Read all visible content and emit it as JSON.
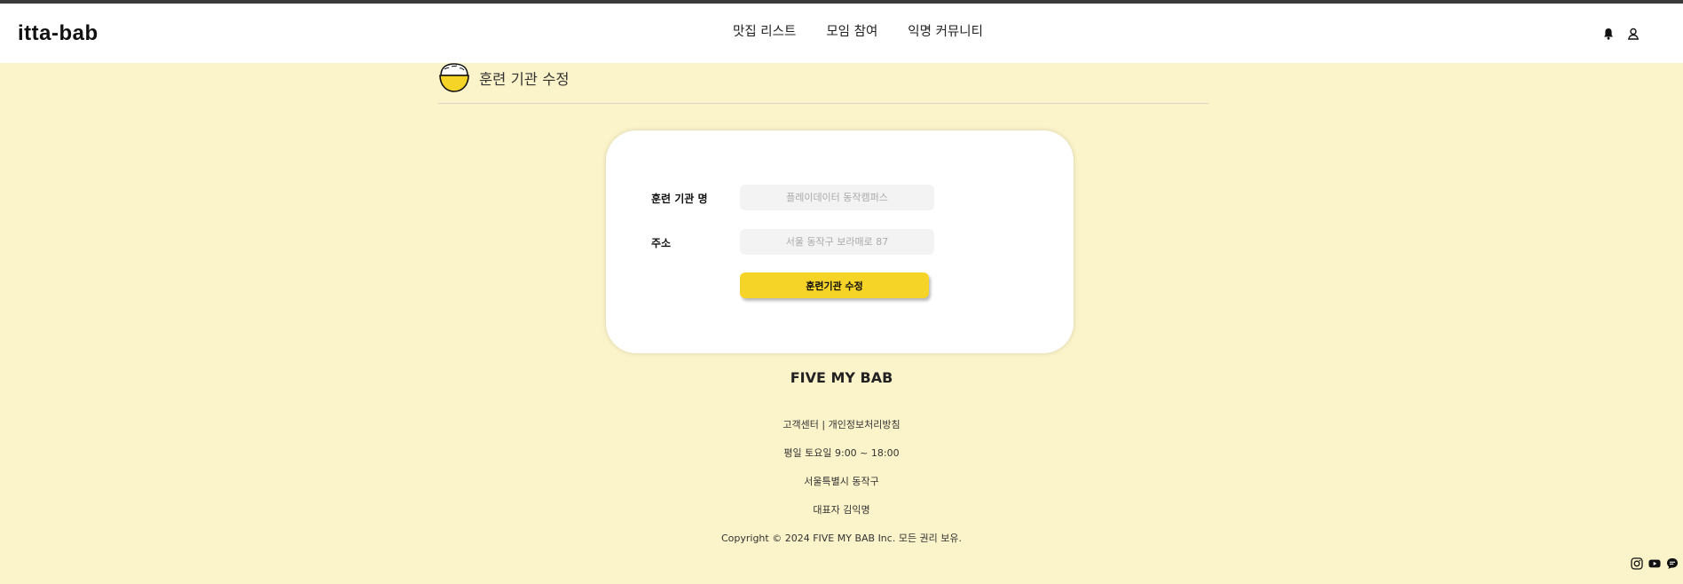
{
  "app": {
    "logo": "itta-bab"
  },
  "nav": {
    "items": [
      "맛집 리스트",
      "모임 참여",
      "익명 커뮤니티"
    ]
  },
  "header_icons": [
    "bell-icon",
    "user-icon"
  ],
  "page": {
    "title": "훈련 기관 수정"
  },
  "form": {
    "name_label": "훈련 기관 명",
    "name_placeholder": "플레이데이터 동작캠퍼스",
    "address_label": "주소",
    "address_placeholder": "서울 동작구 보라매로 87",
    "submit_label": "훈련기관 수정"
  },
  "footer": {
    "brand": "FIVE MY BAB",
    "support": "고객센터",
    "separator": "|",
    "privacy": "개인정보처리방침",
    "hours": "평일 토요일 9:00 ~ 18:00",
    "address": "서울특별시 동작구",
    "ceo": "대표자  김익명",
    "copyright": "Copyright © 2024 FIVE MY BAB Inc. 모든 권리 보유."
  },
  "social_icons": [
    "instagram-icon",
    "youtube-icon",
    "chat-icon"
  ],
  "colors": {
    "background": "#fbf3c9",
    "accent": "#f5d327",
    "card": "#ffffff"
  }
}
